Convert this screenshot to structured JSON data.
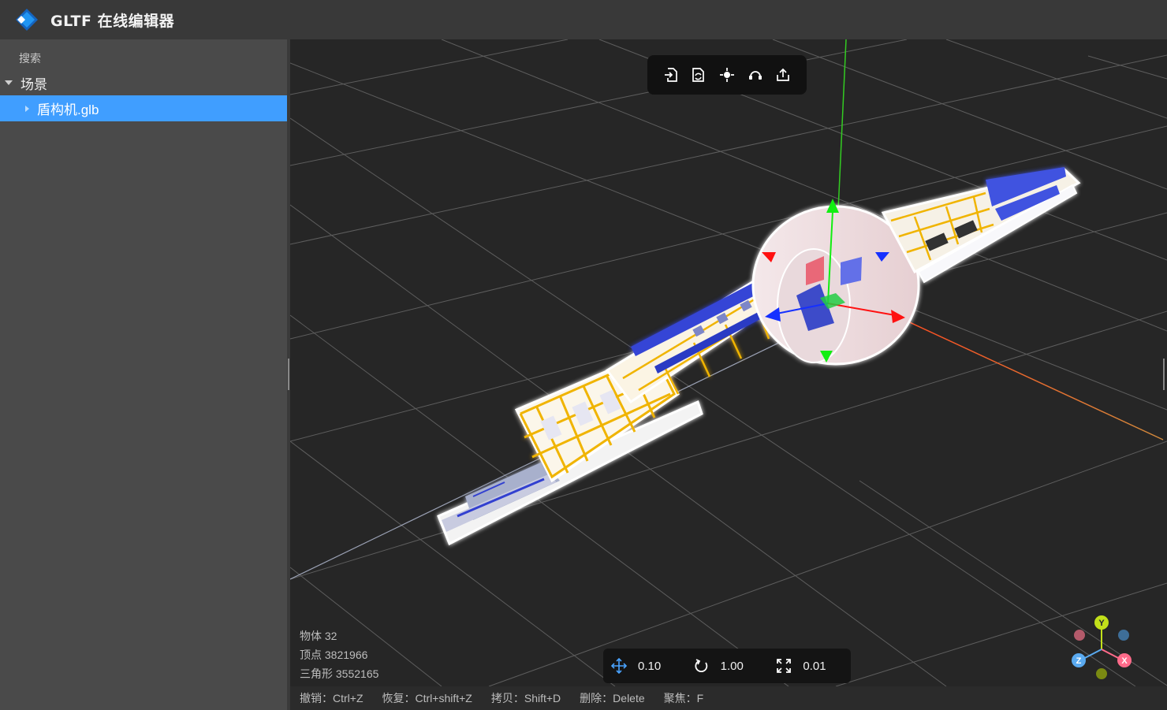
{
  "header": {
    "title": "GLTF 在线编辑器",
    "logo_colors": [
      "#1e88e5",
      "#5db8ff",
      "#ffffff"
    ]
  },
  "sidebar": {
    "search_label": "搜索",
    "tree": {
      "root_label": "场景",
      "items": [
        {
          "label": "盾构机.glb",
          "selected": true
        }
      ]
    }
  },
  "toolbar": {
    "buttons": [
      {
        "icon": "import-icon"
      },
      {
        "icon": "replace-file-icon"
      },
      {
        "icon": "focus-center-icon"
      },
      {
        "icon": "rotate-reset-icon"
      },
      {
        "icon": "export-icon"
      }
    ]
  },
  "stats": {
    "objects": "物体 32",
    "vertices": "顶点 3821966",
    "triangles": "三角形 3552165"
  },
  "transform": {
    "translate_snap": "0.10",
    "rotate_snap": "1.00",
    "scale_snap": "0.01"
  },
  "statusbar": {
    "undo": "撤销：Ctrl+Z",
    "redo": "恢复：Ctrl+shift+Z",
    "copy": "拷贝：Shift+D",
    "delete": "删除：Delete",
    "focus": "聚焦：F"
  },
  "axis_gizmo": {
    "y_label": "Y",
    "x_label": "X",
    "z_label": "Z",
    "colors": {
      "x": "#ff6b8a",
      "y": "#c2e01a",
      "z": "#5aaaf0"
    }
  },
  "colors": {
    "accent": "#409eff",
    "axis_x": "#ff2020",
    "axis_y": "#22dd22",
    "axis_z": "#1530ff"
  }
}
